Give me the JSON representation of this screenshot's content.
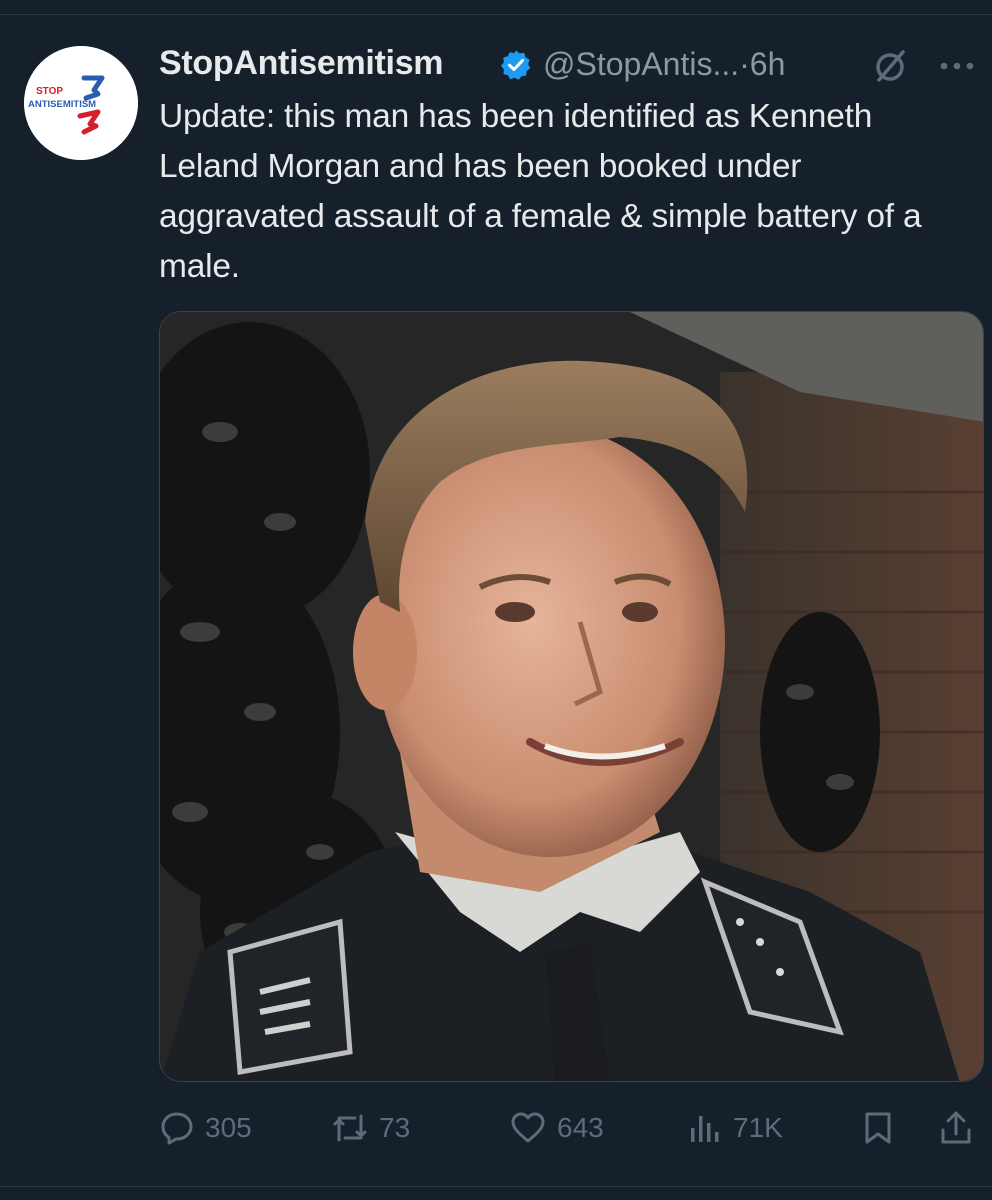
{
  "author": {
    "display_name": "StopAntisemitism",
    "handle": "@StopAntis...",
    "time_separator": "·",
    "time": "6h",
    "verified": true,
    "avatar_icon": "stop-antisemitism-logo",
    "avatar_logo_text": {
      "line1": "STOP",
      "line2": "ANTISEMITISM"
    }
  },
  "tweet": {
    "text": "Update: this man has been identified as Kenneth Leland Morgan and has been booked under aggravated assault of a female & simple battery of a male.",
    "media_description_icon": "photo-of-man-in-uniform"
  },
  "actions": {
    "reply": {
      "icon": "reply-icon",
      "count": "305"
    },
    "retweet": {
      "icon": "retweet-icon",
      "count": "73"
    },
    "like": {
      "icon": "heart-icon",
      "count": "643"
    },
    "views": {
      "icon": "views-icon",
      "count": "71K"
    },
    "bookmark": {
      "icon": "bookmark-icon"
    },
    "share": {
      "icon": "share-icon"
    }
  },
  "colors": {
    "background": "#15202b",
    "text_primary": "#e7e9ea",
    "text_secondary": "#8b98a5",
    "action_icons": "#5b6c7c",
    "verified_blue": "#1d9bf0",
    "logo_red": "#d4202c",
    "logo_blue": "#2a5db0"
  }
}
